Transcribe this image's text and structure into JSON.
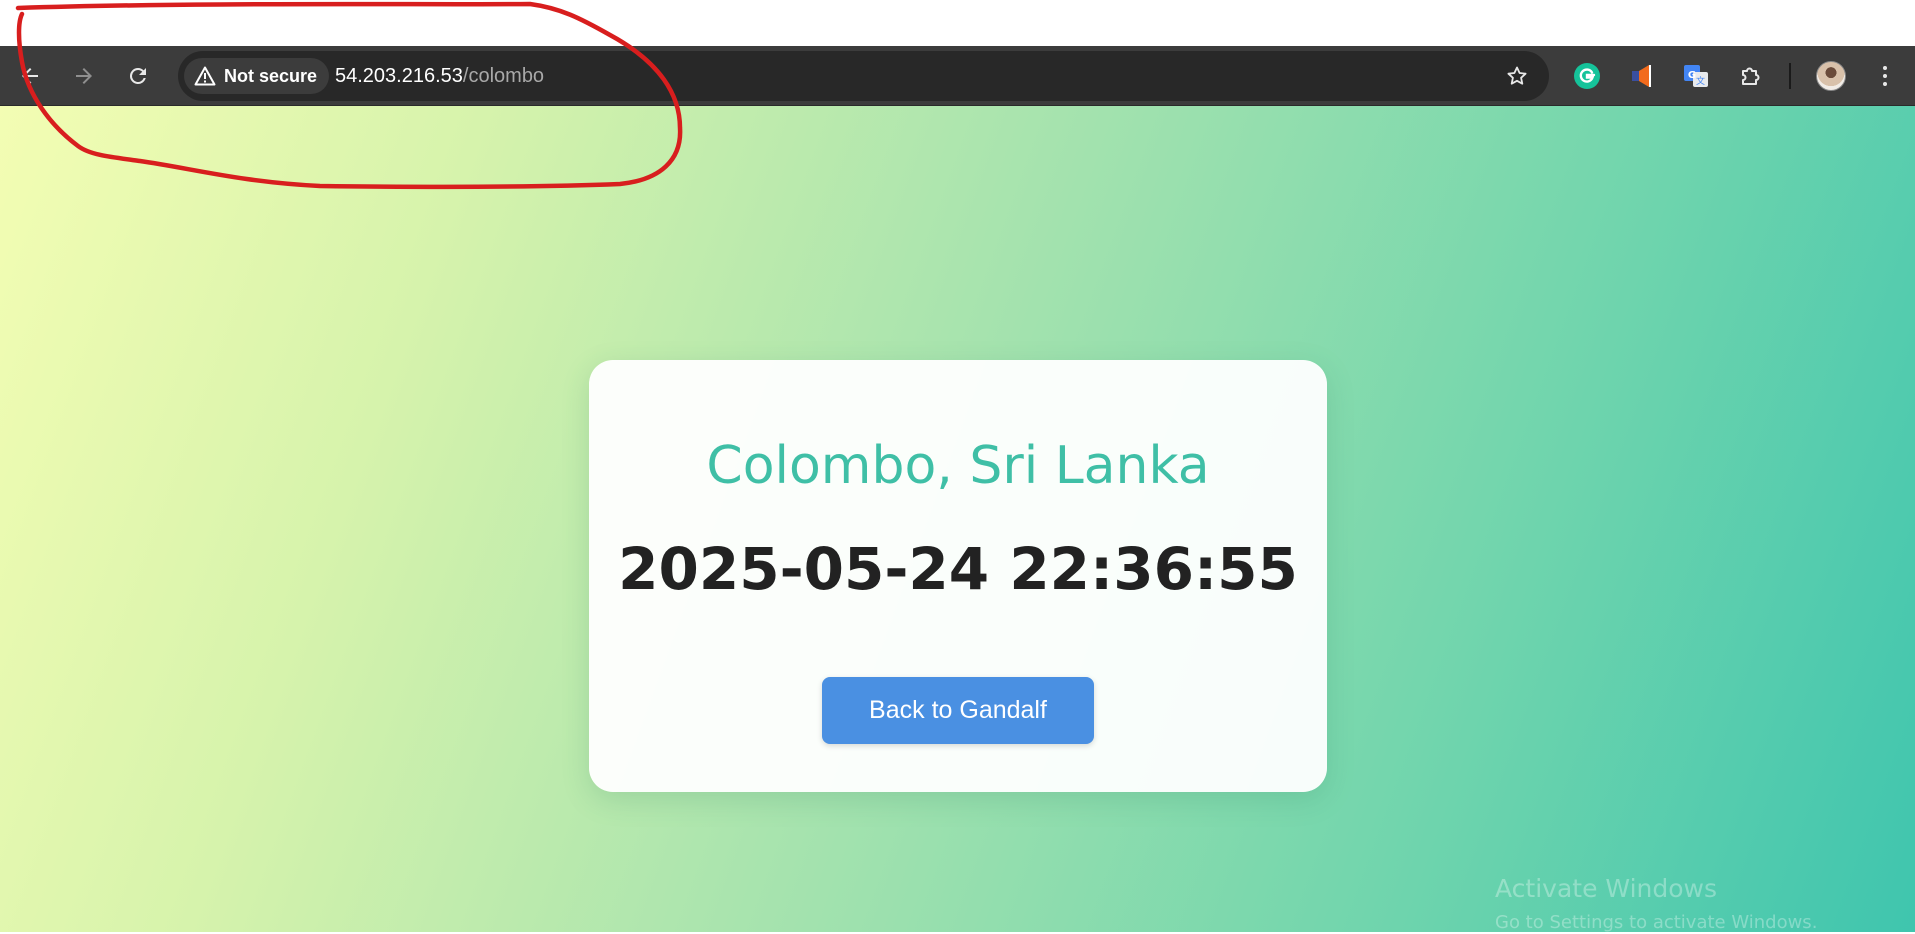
{
  "browser": {
    "security_label": "Not secure",
    "url_host": "54.203.216.53",
    "url_path": "/colombo",
    "icons": {
      "back": "arrow-left-icon",
      "forward": "arrow-right-icon",
      "reload": "reload-icon",
      "warning": "warning-triangle-icon",
      "bookmark": "star-icon",
      "grammarly": "grammarly-extension-icon",
      "extension2": "orange-extension-icon",
      "translate": "google-translate-extension-icon",
      "extensions": "puzzle-icon",
      "profile": "avatar",
      "menu": "kebab-menu-icon"
    },
    "colors": {
      "toolbar": "#3c3c3c",
      "omnibox": "#282828"
    }
  },
  "page": {
    "city": "Colombo, Sri Lanka",
    "datetime": "2025-05-24 22:36:55",
    "back_button_label": "Back to Gandalf",
    "colors": {
      "gradient_start": "#f3fdb3",
      "gradient_end": "#3fc5ae",
      "city_text": "#3fbfa6",
      "button": "#4a90e2"
    }
  },
  "os_watermark": {
    "title": "Activate Windows",
    "subtitle": "Go to Settings to activate Windows."
  },
  "annotation": {
    "color": "#d81e1e",
    "shape": "hand-drawn-circle-around-address-bar"
  }
}
